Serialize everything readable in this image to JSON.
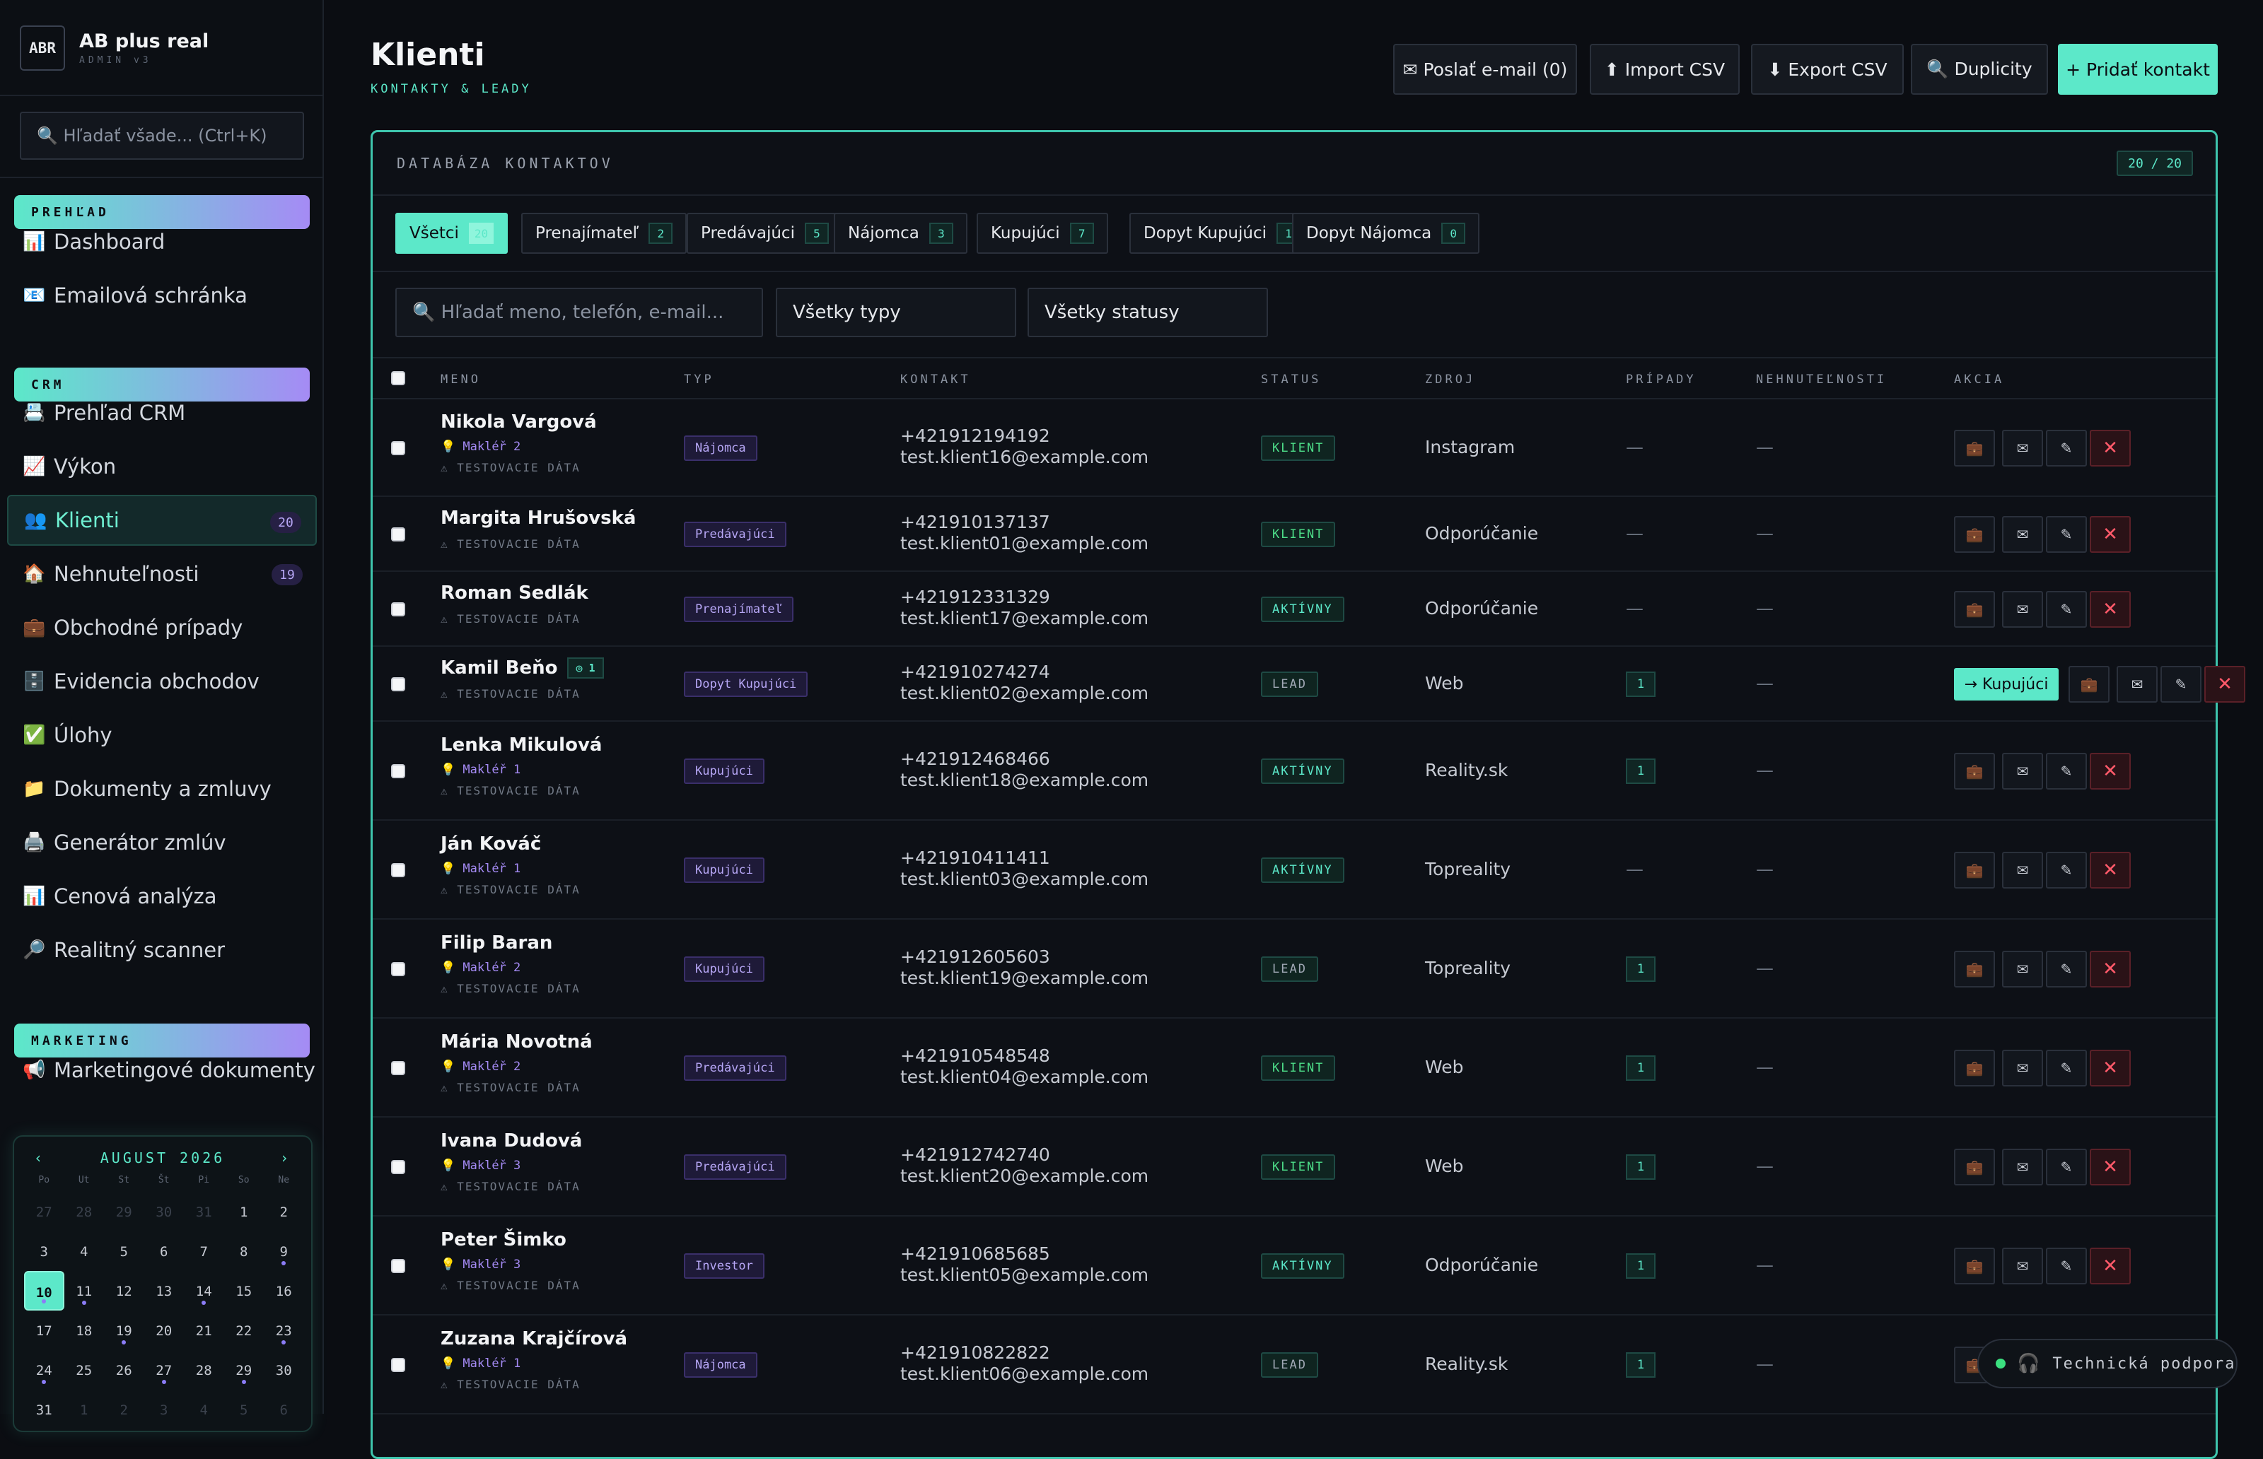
{
  "brand": {
    "logo": "ABR",
    "title": "AB plus real",
    "subtitle": "ADMIN v3"
  },
  "sidebar": {
    "search_placeholder": "🔍 Hľadať všade... (Ctrl+K)",
    "sections": [
      {
        "label": "PREHĽAD",
        "items": [
          {
            "icon": "📊",
            "label": "Dashboard"
          },
          {
            "icon": "📧",
            "label": "Emailová schránka"
          }
        ]
      },
      {
        "label": "CRM",
        "items": [
          {
            "icon": "📇",
            "label": "Prehľad CRM"
          },
          {
            "icon": "📈",
            "label": "Výkon"
          },
          {
            "icon": "👥",
            "label": "Klienti",
            "badge": "20",
            "active": true
          },
          {
            "icon": "🏠",
            "label": "Nehnuteľnosti",
            "badge": "19"
          },
          {
            "icon": "💼",
            "label": "Obchodné prípady"
          },
          {
            "icon": "🗄️",
            "label": "Evidencia obchodov"
          },
          {
            "icon": "✅",
            "label": "Úlohy"
          },
          {
            "icon": "📁",
            "label": "Dokumenty a zmluvy"
          },
          {
            "icon": "🖨️",
            "label": "Generátor zmlúv"
          },
          {
            "icon": "📊",
            "label": "Cenová analýza"
          },
          {
            "icon": "🔎",
            "label": "Realitný scanner"
          }
        ]
      },
      {
        "label": "MARKETING",
        "items": [
          {
            "icon": "📢",
            "label": "Marketingové dokumenty"
          }
        ]
      }
    ]
  },
  "calendar": {
    "prev": "‹",
    "next": "›",
    "month": "AUGUST 2026",
    "dow": [
      "Po",
      "Ut",
      "St",
      "Št",
      "Pi",
      "So",
      "Ne"
    ],
    "days": [
      {
        "d": "27",
        "o": true
      },
      {
        "d": "28",
        "o": true
      },
      {
        "d": "29",
        "o": true
      },
      {
        "d": "30",
        "o": true
      },
      {
        "d": "31",
        "o": true
      },
      {
        "d": "1"
      },
      {
        "d": "2"
      },
      {
        "d": "3"
      },
      {
        "d": "4"
      },
      {
        "d": "5"
      },
      {
        "d": "6"
      },
      {
        "d": "7"
      },
      {
        "d": "8"
      },
      {
        "d": "9",
        "dot": true
      },
      {
        "d": "10",
        "today": true,
        "dot": true
      },
      {
        "d": "11",
        "dot": true
      },
      {
        "d": "12"
      },
      {
        "d": "13"
      },
      {
        "d": "14",
        "dot": true
      },
      {
        "d": "15"
      },
      {
        "d": "16"
      },
      {
        "d": "17"
      },
      {
        "d": "18"
      },
      {
        "d": "19",
        "dot": true
      },
      {
        "d": "20"
      },
      {
        "d": "21"
      },
      {
        "d": "22"
      },
      {
        "d": "23",
        "dot": true
      },
      {
        "d": "24",
        "dot": true
      },
      {
        "d": "25"
      },
      {
        "d": "26"
      },
      {
        "d": "27",
        "dot": true
      },
      {
        "d": "28"
      },
      {
        "d": "29",
        "dot": true
      },
      {
        "d": "30"
      },
      {
        "d": "31"
      },
      {
        "d": "1",
        "o": true
      },
      {
        "d": "2",
        "o": true
      },
      {
        "d": "3",
        "o": true
      },
      {
        "d": "4",
        "o": true
      },
      {
        "d": "5",
        "o": true
      },
      {
        "d": "6",
        "o": true
      }
    ]
  },
  "header": {
    "title": "Klienti",
    "subtitle": "KONTAKTY & LEADY",
    "buttons": {
      "email": "✉ Poslať e-mail (0)",
      "import": "⬆ Import CSV",
      "export": "⬇ Export CSV",
      "dup": "🔍 Duplicity",
      "add": "+ Pridať kontakt"
    }
  },
  "panel": {
    "title": "DATABÁZA KONTAKTOV",
    "count": "20 / 20"
  },
  "filter_tabs": [
    {
      "label": "Všetci",
      "count": "20",
      "active": true
    },
    {
      "label": "Prenajímateľ",
      "count": "2"
    },
    {
      "label": "Predávajúci",
      "count": "5"
    },
    {
      "label": "Nájomca",
      "count": "3"
    },
    {
      "label": "Kupujúci",
      "count": "7"
    },
    {
      "label": "Dopyt Kupujúci",
      "count": "1"
    },
    {
      "label": "Dopyt Nájomca",
      "count": "0"
    }
  ],
  "filters": {
    "search_placeholder": "🔍 Hľadať meno, telefón, e-mail...",
    "type": "Všetky typy",
    "status": "Všetky statusy"
  },
  "columns": {
    "name": "MENO",
    "type": "TYP",
    "contact": "KONTAKT",
    "status": "STATUS",
    "source": "ZDROJ",
    "cases": "PRÍPADY",
    "properties": "NEHNUTEĽNOSTI",
    "actions": "AKCIA"
  },
  "test_label": "⚠ TESTOVACIE DÁTA",
  "dash": "—",
  "actions": {
    "case": "💼",
    "mail": "✉",
    "edit": "✎",
    "del": "✕",
    "convert": "→ Kupujúci"
  },
  "rows": [
    {
      "name": "Nikola Vargová",
      "makler": "💡 Makléř 2",
      "type": "Nájomca",
      "phone": "+421912194192",
      "email": "test.klient16@example.com",
      "status": "KLIENT",
      "source": "Instagram",
      "cases": "—",
      "props": "—"
    },
    {
      "name": "Margita Hrušovská",
      "type": "Predávajúci",
      "phone": "+421910137137",
      "email": "test.klient01@example.com",
      "status": "KLIENT",
      "source": "Odporúčanie",
      "cases": "—",
      "props": "—"
    },
    {
      "name": "Roman Sedlák",
      "type": "Prenajímateľ",
      "phone": "+421912331329",
      "email": "test.klient17@example.com",
      "status": "AKTÍVNY",
      "source": "Odporúčanie",
      "cases": "—",
      "props": "—"
    },
    {
      "name": "Kamil Beňo",
      "badge": "◎ 1",
      "type": "Dopyt Kupujúci",
      "phone": "+421910274274",
      "email": "test.klient02@example.com",
      "status": "LEAD",
      "source": "Web",
      "cases": "1",
      "props": "—",
      "convert": true
    },
    {
      "name": "Lenka Mikulová",
      "makler": "💡 Makléř 1",
      "type": "Kupujúci",
      "phone": "+421912468466",
      "email": "test.klient18@example.com",
      "status": "AKTÍVNY",
      "source": "Reality.sk",
      "cases": "1",
      "props": "—"
    },
    {
      "name": "Ján Kováč",
      "makler": "💡 Makléř 1",
      "type": "Kupujúci",
      "phone": "+421910411411",
      "email": "test.klient03@example.com",
      "status": "AKTÍVNY",
      "source": "Topreality",
      "cases": "—",
      "props": "—"
    },
    {
      "name": "Filip Baran",
      "makler": "💡 Makléř 2",
      "type": "Kupujúci",
      "phone": "+421912605603",
      "email": "test.klient19@example.com",
      "status": "LEAD",
      "source": "Topreality",
      "cases": "1",
      "props": "—"
    },
    {
      "name": "Mária Novotná",
      "makler": "💡 Makléř 2",
      "type": "Predávajúci",
      "phone": "+421910548548",
      "email": "test.klient04@example.com",
      "status": "KLIENT",
      "source": "Web",
      "cases": "1",
      "props": "—"
    },
    {
      "name": "Ivana Dudová",
      "makler": "💡 Makléř 3",
      "type": "Predávajúci",
      "phone": "+421912742740",
      "email": "test.klient20@example.com",
      "status": "KLIENT",
      "source": "Web",
      "cases": "1",
      "props": "—"
    },
    {
      "name": "Peter Šimko",
      "makler": "💡 Makléř 3",
      "type": "Investor",
      "phone": "+421910685685",
      "email": "test.klient05@example.com",
      "status": "AKTÍVNY",
      "source": "Odporúčanie",
      "cases": "1",
      "props": "—"
    },
    {
      "name": "Zuzana Krajčírová",
      "makler": "💡 Makléř 1",
      "type": "Nájomca",
      "phone": "+421910822822",
      "email": "test.klient06@example.com",
      "status": "LEAD",
      "source": "Reality.sk",
      "cases": "1",
      "props": "—"
    }
  ],
  "status_colors": {
    "KLIENT": "#4ee08a",
    "AKTÍVNY": "#5ce8c9",
    "LEAD": "#a0a8b5"
  },
  "support": {
    "label": "Technická podpora",
    "icon": "🎧"
  }
}
